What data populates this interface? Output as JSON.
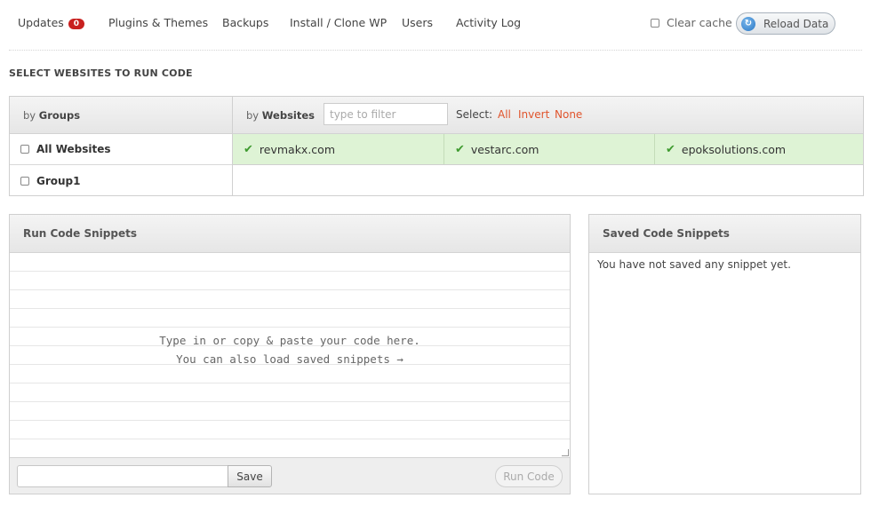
{
  "nav": {
    "updates_label": "Updates",
    "updates_count": "0",
    "plugins_themes": "Plugins & Themes",
    "backups": "Backups",
    "install_clone": "Install / Clone WP",
    "users": "Users",
    "activity_log": "Activity Log",
    "clear_cache": "Clear cache",
    "reload_data": "Reload Data"
  },
  "section_title": "SELECT WEBSITES TO RUN CODE",
  "selector": {
    "by_groups_prefix": "by",
    "by_groups": "Groups",
    "by_websites_prefix": "by",
    "by_websites": "Websites",
    "filter_placeholder": "type to filter",
    "select_label": "Select:",
    "select_all": "All",
    "select_invert": "Invert",
    "select_none": "None",
    "groups": [
      "All Websites",
      "Group1"
    ],
    "websites": [
      "revmakx.com",
      "vestarc.com",
      "epoksolutions.com"
    ]
  },
  "run_panel": {
    "title": "Run Code Snippets",
    "placeholder_line1": "Type in or copy & paste your code here.",
    "placeholder_line2": "You can also load saved snippets →",
    "save_label": "Save",
    "run_label": "Run Code"
  },
  "saved_panel": {
    "title": "Saved Code Snippets",
    "empty_text": "You have not saved any snippet yet."
  },
  "colors": {
    "badge": "#c8201f",
    "link_accent": "#e0542c",
    "selected_row": "#def3d5",
    "check": "#3e9a2f"
  }
}
